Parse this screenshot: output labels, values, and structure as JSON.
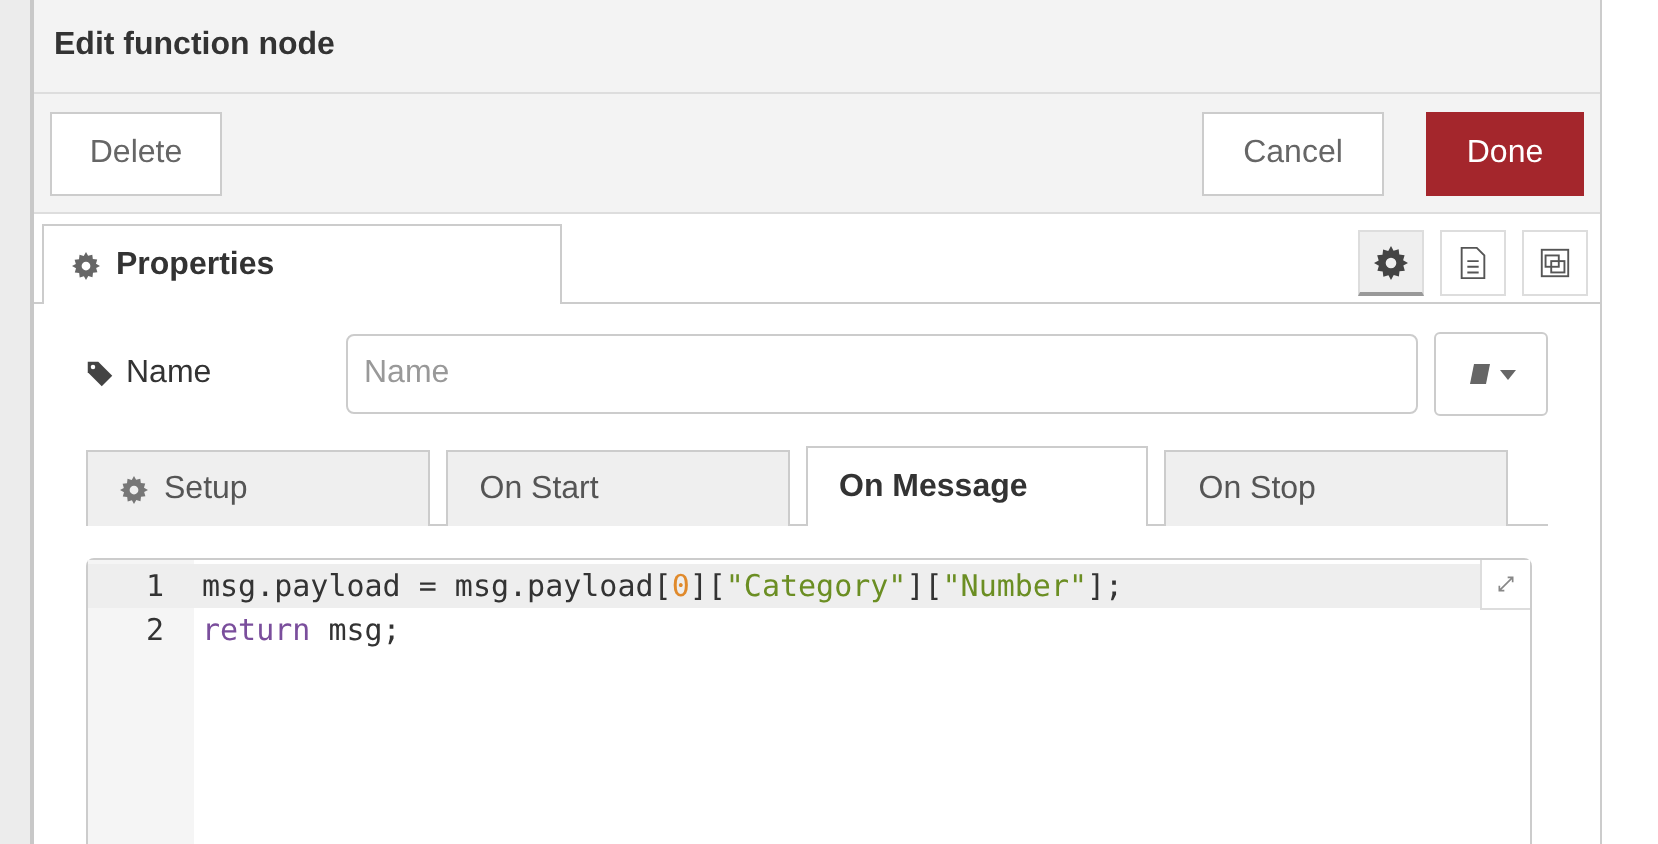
{
  "dialog": {
    "title": "Edit function node"
  },
  "actions": [
    {
      "label": "Delete",
      "kind": "plain"
    },
    {
      "label": "Cancel",
      "kind": "plain"
    },
    {
      "label": "Done",
      "kind": "primary"
    }
  ],
  "main_tab": {
    "label": "Properties",
    "selected": true
  },
  "tool_icons": [
    {
      "kind": "gear",
      "selected": true
    },
    {
      "kind": "document",
      "selected": false
    },
    {
      "kind": "frame",
      "selected": false
    }
  ],
  "name_field": {
    "label": "Name",
    "placeholder": "Name"
  },
  "sub_tabs": [
    {
      "label": "Setup",
      "icon": true,
      "selected": false
    },
    {
      "label": "On Start",
      "icon": false,
      "selected": false
    },
    {
      "label": "On Message",
      "icon": false,
      "selected": true
    },
    {
      "label": "On Stop",
      "icon": false,
      "selected": false
    }
  ],
  "editor": {
    "lines": [
      {
        "number": "1",
        "active": true,
        "tokens": [
          {
            "text": "msg.payload = msg.payload[",
            "kind": "plain"
          },
          {
            "text": "0",
            "kind": "number"
          },
          {
            "text": "][",
            "kind": "plain"
          },
          {
            "text": "\"Category\"",
            "kind": "string"
          },
          {
            "text": "][",
            "kind": "plain"
          },
          {
            "text": "\"Number\"",
            "kind": "string"
          },
          {
            "text": "];",
            "kind": "plain"
          }
        ]
      },
      {
        "number": "2",
        "active": false,
        "tokens": [
          {
            "text": "return",
            "kind": "keyword"
          },
          {
            "text": " msg;",
            "kind": "plain"
          }
        ]
      }
    ]
  }
}
